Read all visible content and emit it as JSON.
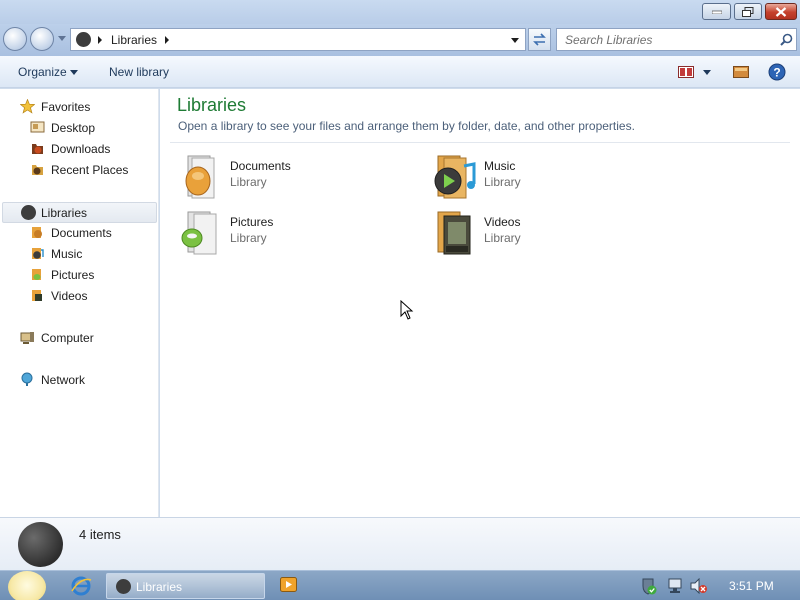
{
  "window": {
    "minimize_icon": "minimize-icon",
    "maximize_icon": "restore-icon",
    "close_icon": "close-icon"
  },
  "address": {
    "breadcrumb": "Libraries",
    "search_placeholder": "Search Libraries"
  },
  "toolbar": {
    "organize_label": "Organize",
    "new_library_label": "New library"
  },
  "nav": {
    "favorites": "Favorites",
    "desktop": "Desktop",
    "downloads": "Downloads",
    "recent_places": "Recent Places",
    "libraries": "Libraries",
    "documents": "Documents",
    "music": "Music",
    "pictures": "Pictures",
    "videos": "Videos",
    "computer": "Computer",
    "network": "Network"
  },
  "content": {
    "title": "Libraries",
    "subtitle": "Open a library to see your files and arrange them by folder, date, and other properties.",
    "libraries": [
      {
        "name": "Documents",
        "type": "Library"
      },
      {
        "name": "Music",
        "type": "Library"
      },
      {
        "name": "Pictures",
        "type": "Library"
      },
      {
        "name": "Videos",
        "type": "Library"
      }
    ]
  },
  "details": {
    "count": "4 items"
  },
  "taskbar": {
    "task_label": "Libraries",
    "clock": "3:51 PM"
  },
  "colors": {
    "title_green": "#1e7b34",
    "close_red": "#c5412c",
    "taskbar_blue": "#7d9abd"
  }
}
